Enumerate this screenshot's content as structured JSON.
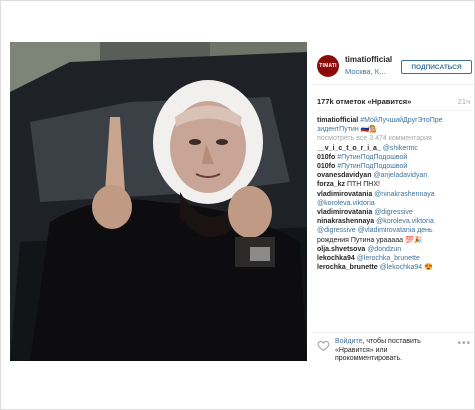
{
  "header": {
    "avatar_text": "TIMATI",
    "username": "timatiofficial",
    "location": "Москва, К...",
    "follow_label": "ПОДПИСАТЬСЯ"
  },
  "meta": {
    "likes": "177k отметок «Нравится»",
    "time": "21ч"
  },
  "caption": {
    "user": "timatiofficial",
    "text_line1": "#МойЛучшийДругЭтоПре",
    "text_line2": "зидентПутин 🇷🇺💁🏼",
    "view_all": "посмотреть все 3.474 комментария"
  },
  "comments": [
    {
      "user": "__v_i_c_t_o_r_i_a_",
      "text": "@shikermc"
    },
    {
      "user": "010fo",
      "text": "#ПутинПодПодошвой"
    },
    {
      "user": "010fo",
      "text": "#ПутинПодПодошвой"
    },
    {
      "user": "ovanesdavidyan",
      "text": "@anjeladavidyan"
    },
    {
      "user": "forza_kz",
      "text": "ПТН ПНХ!"
    },
    {
      "user": "vladimirovatania",
      "text": "@ninakrashennaya"
    },
    {
      "user": "",
      "text": "@koroleva.viktoria"
    },
    {
      "user": "vladimirovatania",
      "text": "@digressive"
    },
    {
      "user": "ninakrashennaya",
      "text": "@koroleva.viktoria"
    },
    {
      "user": "",
      "text": "@digressive @vladimirovatania день"
    },
    {
      "user": "",
      "text": "рождения Путина урааааа 💯🎉"
    },
    {
      "user": "olja.shvetsova",
      "text": "@dondzun"
    },
    {
      "user": "lekochka94",
      "text": "@lerochka_brunette"
    },
    {
      "user": "lerochka_brunette",
      "text": "@lekochka94 😍"
    }
  ],
  "login_prompt": {
    "link": "Войдите",
    "text": ", чтобы поставить «Нравится» или прокомментировать."
  },
  "more_label": "•••"
}
